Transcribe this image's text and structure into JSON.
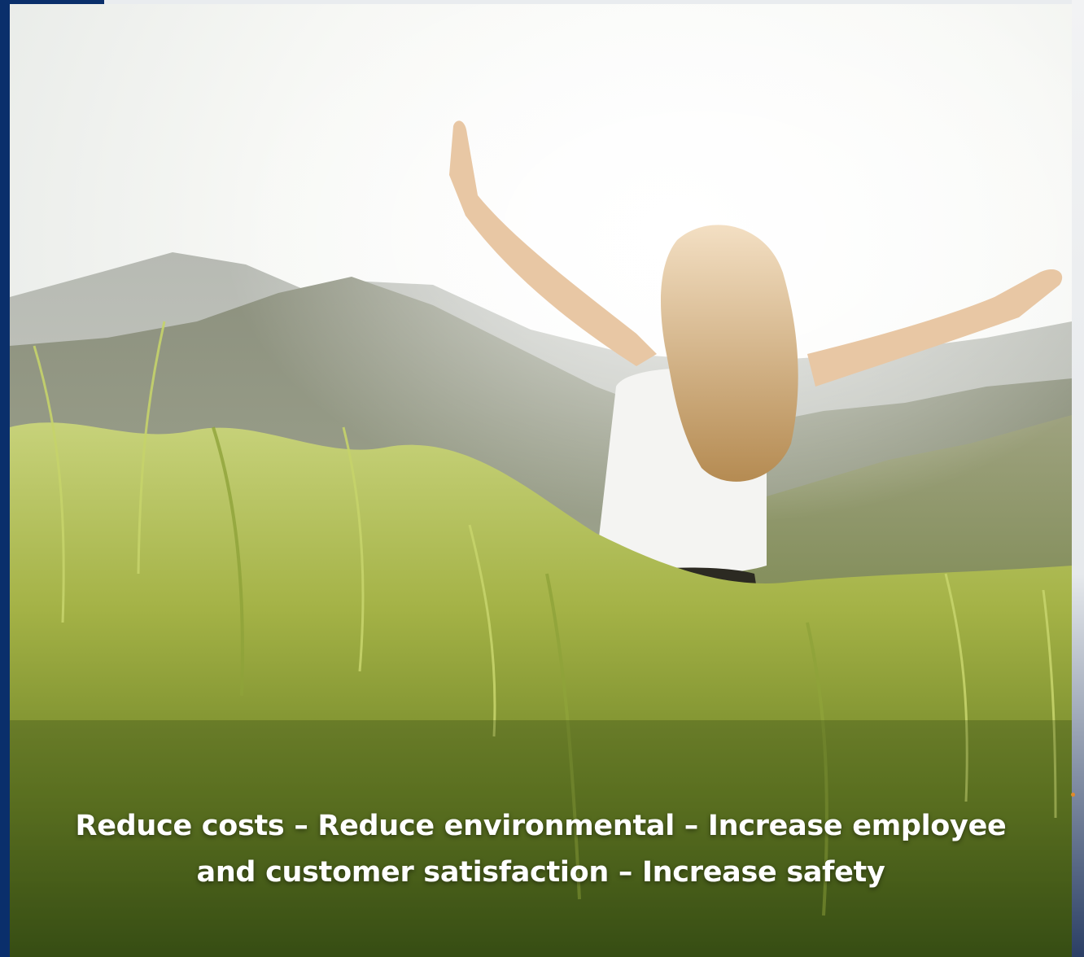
{
  "slide": {
    "caption_line1": "Reduce costs – Reduce environmental – Increase employee",
    "caption_line2": "and customer satisfaction – Increase safety"
  },
  "colors": {
    "frame_blue": "#0a2f6b",
    "grass_green": "#7f9a2c",
    "sky": "#f7f8f6",
    "caption_text": "#ffffff"
  }
}
